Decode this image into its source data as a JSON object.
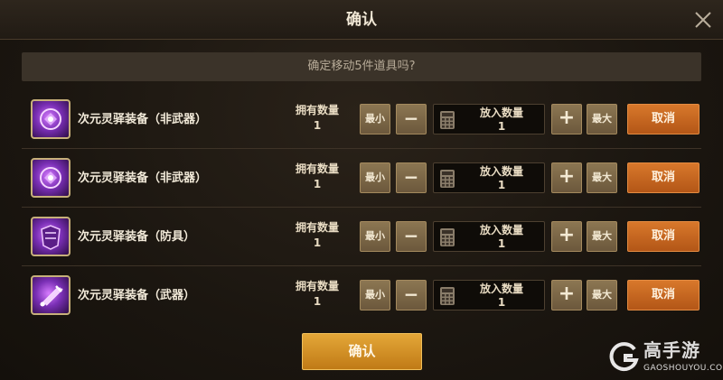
{
  "dialog": {
    "title": "确认",
    "prompt": "确定移动5件道具吗?",
    "confirm_label": "确认"
  },
  "labels": {
    "owned": "拥有数量",
    "put_in": "放入数量",
    "min": "最小",
    "minus": "−",
    "plus": "+",
    "max": "最大",
    "cancel": "取消"
  },
  "items": [
    {
      "name": "次元灵驿装备（非武器）",
      "owned": "1",
      "quantity": "1",
      "icon": "purple-armor-orb-icon"
    },
    {
      "name": "次元灵驿装备（非武器）",
      "owned": "1",
      "quantity": "1",
      "icon": "purple-armor-orb-icon"
    },
    {
      "name": "次元灵驿装备（防具）",
      "owned": "1",
      "quantity": "1",
      "icon": "purple-armor-icon"
    },
    {
      "name": "次元灵驿装备（武器）",
      "owned": "1",
      "quantity": "1",
      "icon": "purple-weapon-icon"
    }
  ],
  "watermark": {
    "cn": "高手游",
    "en": "GAOSHOUYOU.COM"
  }
}
